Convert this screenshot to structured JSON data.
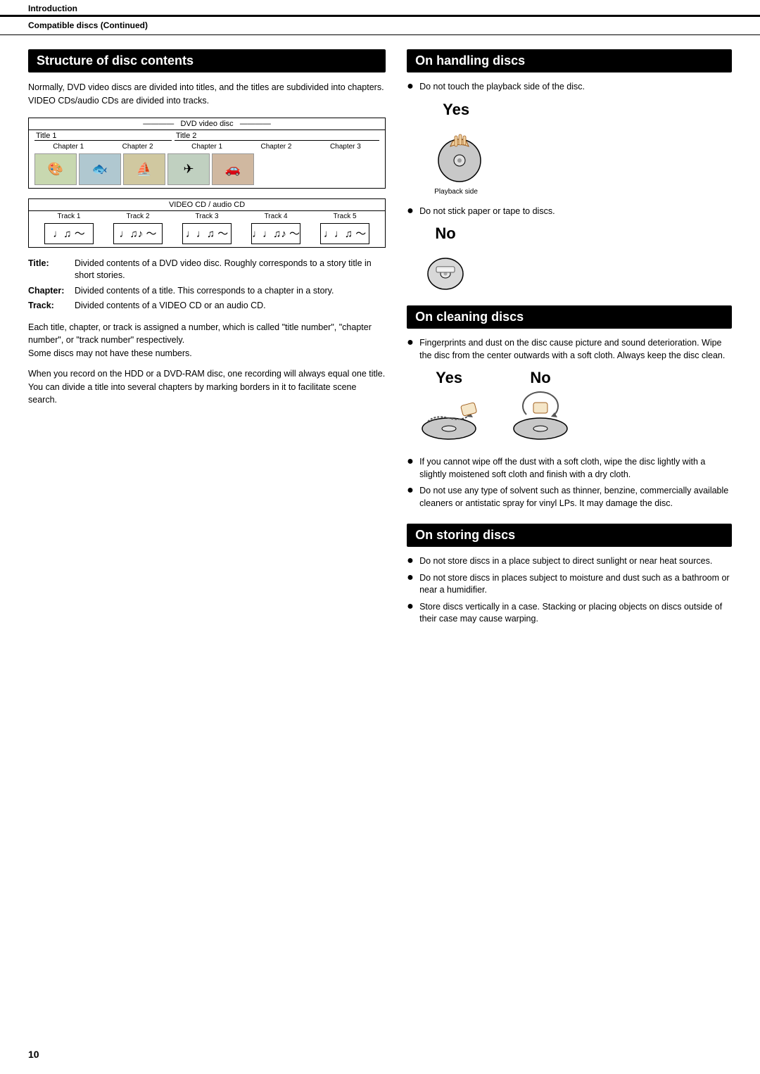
{
  "header": {
    "intro_label": "Introduction",
    "compat_label": "Compatible discs (Continued)"
  },
  "left": {
    "section_title": "Structure of disc contents",
    "intro_text1": "Normally, DVD video discs are divided into titles, and the titles are subdivided into chapters.",
    "intro_text2": "VIDEO CDs/audio CDs are divided into tracks.",
    "dvd_diagram": {
      "title": "DVD video disc",
      "title1": "Title 1",
      "title2": "Title 2",
      "chapters": [
        "Chapter 1",
        "Chapter 2",
        "Chapter 1",
        "Chapter 2",
        "Chapter 3"
      ],
      "thumbs": [
        "🎨",
        "🐟",
        "⛵",
        "✈",
        "🚗"
      ]
    },
    "cd_diagram": {
      "title": "VIDEO CD / audio CD",
      "tracks": [
        "Track 1",
        "Track 2",
        "Track 3",
        "Track 4",
        "Track 5"
      ],
      "music_notes": [
        "♩♫ ～",
        "♩♫♪ ～",
        "♩♩♫ ～",
        "♩♩♫♪ ～",
        "♩♩♫ ～"
      ]
    },
    "definitions": [
      {
        "term": "Title:",
        "desc": "Divided contents of a DVD video disc. Roughly corresponds to a story title in short stories."
      },
      {
        "term": "Chapter:",
        "desc": "Divided contents of a title. This corresponds to a chapter in a story."
      },
      {
        "term": "Track:",
        "desc": "Divided contents of a VIDEO CD or an audio CD."
      }
    ],
    "body1": "Each title, chapter, or track is assigned a number, which is called \"title number\", \"chapter number\", or \"track number\" respectively.\nSome discs may not have these numbers.",
    "body2": "When you record on the HDD or a DVD-RAM disc, one recording will always equal one title. You can divide a title into several chapters by marking borders in it to facilitate scene search."
  },
  "right": {
    "handling": {
      "section_title": "On handling discs",
      "bullet1": "Do not touch the playback side of the disc.",
      "yes_label": "Yes",
      "playback_side": "Playback side",
      "bullet2": "Do not stick paper or tape to discs.",
      "no_label": "No"
    },
    "cleaning": {
      "section_title": "On cleaning discs",
      "bullet1": "Fingerprints and dust on the disc cause picture and sound deterioration. Wipe the disc from the center outwards with a soft cloth. Always keep the disc clean.",
      "yes_label": "Yes",
      "no_label": "No",
      "bullet2": "If you cannot wipe off the dust with a soft cloth, wipe the disc lightly with a slightly moistened soft cloth and finish with a dry cloth.",
      "bullet3": "Do not use any type of solvent such as thinner, benzine, commercially available cleaners or antistatic spray for vinyl LPs. It may damage the disc."
    },
    "storing": {
      "section_title": "On storing discs",
      "bullet1": "Do not store discs in a place subject to direct sunlight or near heat sources.",
      "bullet2": "Do not store discs in places subject to moisture and dust such as a bathroom or near a humidifier.",
      "bullet3": "Store discs vertically in a case. Stacking or placing objects on discs outside of their case may cause warping."
    }
  },
  "page_number": "10"
}
